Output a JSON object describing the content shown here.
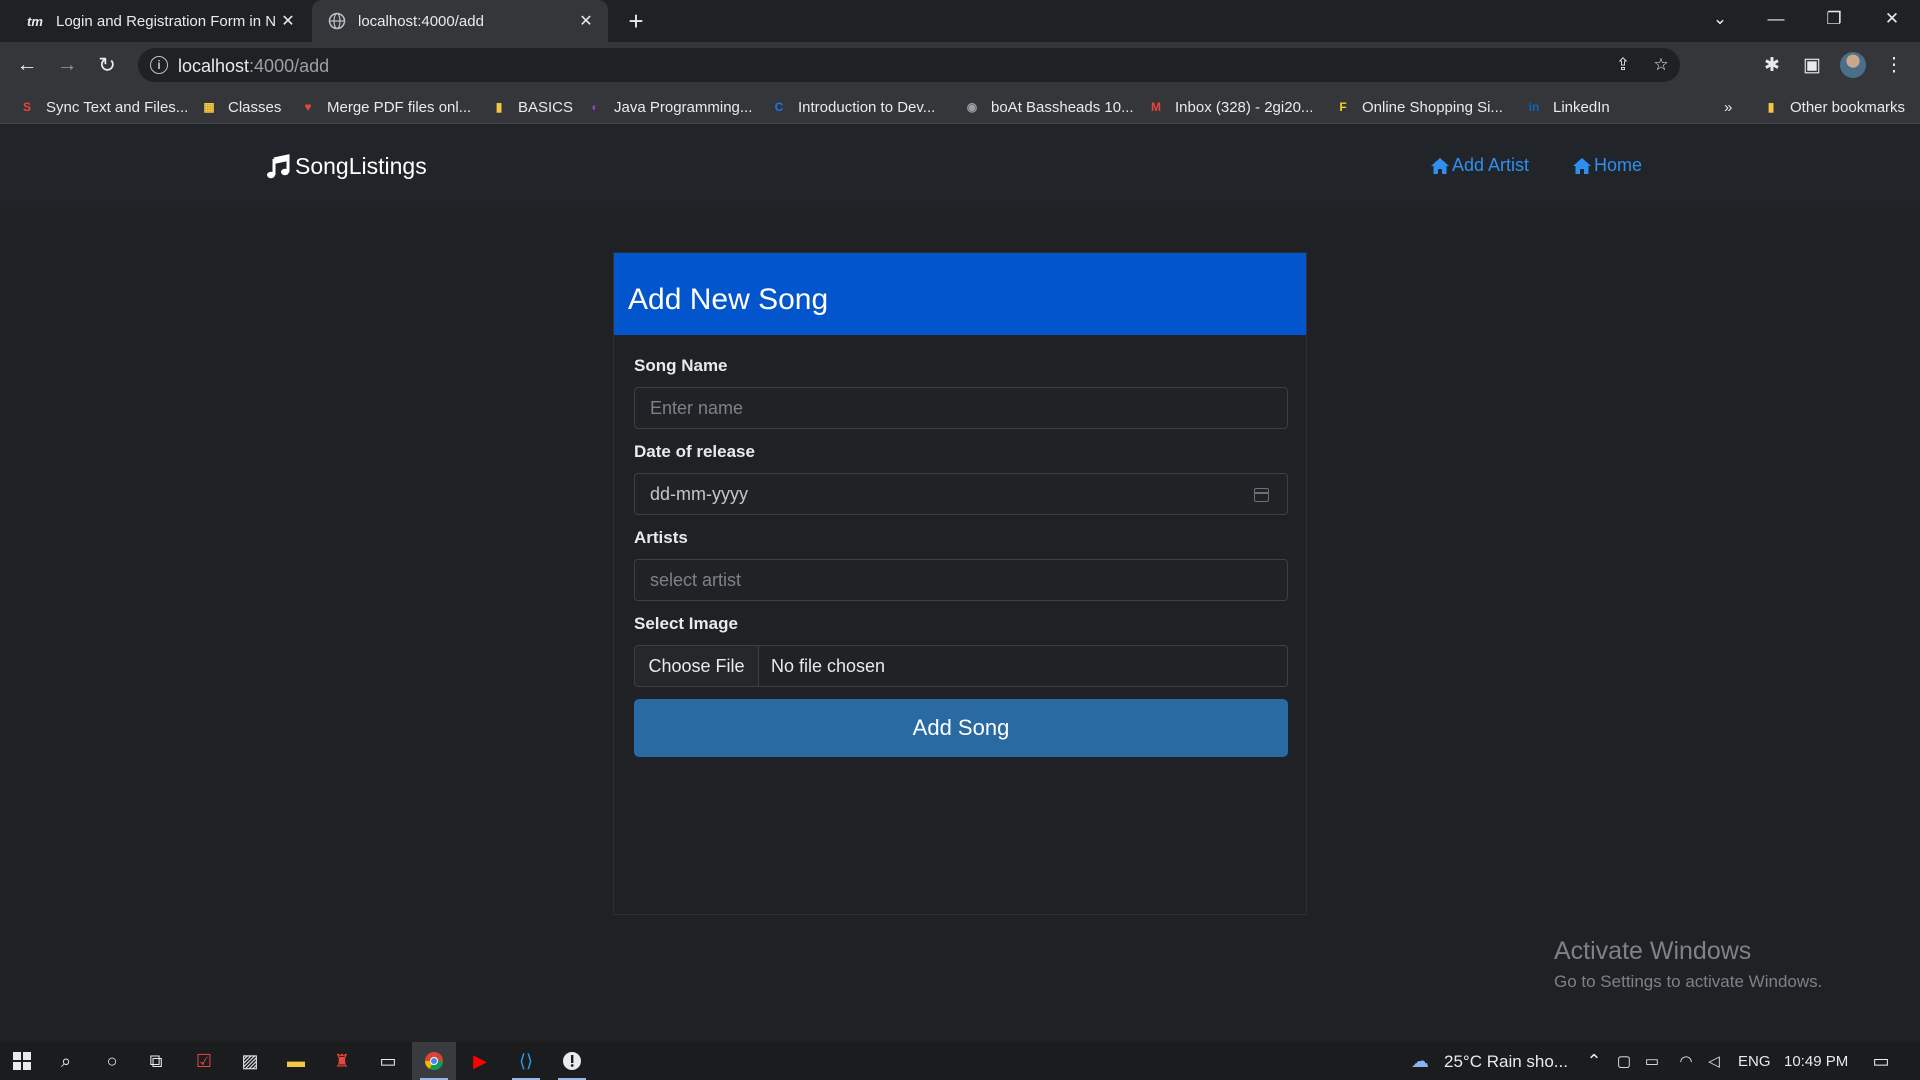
{
  "browser": {
    "tabs": [
      {
        "favicon": "tm",
        "title": "Login and Registration Form in N"
      },
      {
        "favicon": "globe-icon",
        "title": "localhost:4000/add"
      }
    ],
    "url_host": "localhost",
    "url_path": ":4000/add",
    "bookmarks": [
      {
        "icon": "S",
        "color": "#e8453c",
        "label": "Sync Text and Files..."
      },
      {
        "icon": "▦",
        "color": "#f4c542",
        "label": "Classes"
      },
      {
        "icon": "♥",
        "color": "#e8453c",
        "label": "Merge PDF files onl..."
      },
      {
        "icon": "▮",
        "color": "#f4c542",
        "label": "BASICS"
      },
      {
        "icon": "◐",
        "color": "#8e44c9",
        "label": "Java Programming..."
      },
      {
        "icon": "C",
        "color": "#1a73e8",
        "label": "Introduction to Dev..."
      },
      {
        "icon": "◉",
        "color": "#9aa0a6",
        "label": "boAt Bassheads 10..."
      },
      {
        "icon": "M",
        "color": "#e8453c",
        "label": "Inbox (328) - 2gi20..."
      },
      {
        "icon": "F",
        "color": "#f7d117",
        "label": "Online Shopping Si..."
      },
      {
        "icon": "in",
        "color": "#0a66c2",
        "label": "LinkedIn"
      }
    ],
    "more_label": "»",
    "other_bookmarks": "Other bookmarks"
  },
  "navbar": {
    "brand": "SongListings",
    "links": [
      {
        "icon": "home-icon",
        "label": "Add Artist"
      },
      {
        "icon": "home-icon",
        "label": "Home"
      }
    ],
    "link_color": "#2e8ff0"
  },
  "form": {
    "title": "Add New Song",
    "header_color": "#0255cc",
    "song_name": {
      "label": "Song Name",
      "placeholder": "Enter name",
      "value": ""
    },
    "release_date": {
      "label": "Date of release",
      "placeholder": "dd-mm-yyyy"
    },
    "artists": {
      "label": "Artists",
      "placeholder": "select artist"
    },
    "image": {
      "label": "Select Image",
      "button": "Choose File",
      "status": "No file chosen"
    },
    "submit": "Add Song",
    "submit_color": "#2a6aa3"
  },
  "watermark": {
    "title": "Activate Windows",
    "subtitle": "Go to Settings to activate Windows."
  },
  "taskbar": {
    "weather": "25°C  Rain sho...",
    "language": "ENG",
    "time": "10:49 PM"
  }
}
